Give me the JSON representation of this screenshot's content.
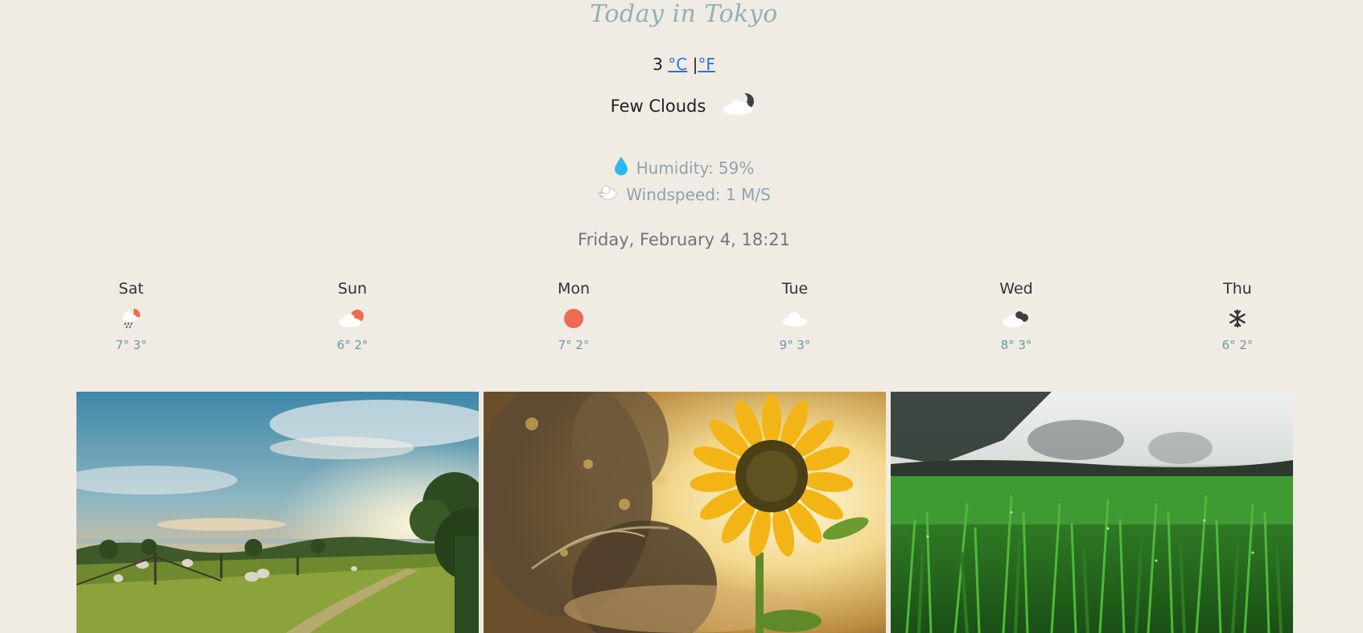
{
  "header": {
    "title": "Today in Tokyo"
  },
  "current": {
    "temp": "3",
    "unit_c": "°C",
    "separator": "|",
    "unit_f": "°F",
    "condition": "Few Clouds",
    "condition_icon": "cloud-moon-icon",
    "humidity_label": "Humidity: 59%",
    "humidity_icon": "water-drop-icon",
    "wind_label": "Windspeed: 1 M/S",
    "wind_icon": "wind-icon",
    "datetime": "Friday, February 4, 18:21"
  },
  "forecast": [
    {
      "day": "Sat",
      "temps": "7° 3°",
      "icon": "sun-cloud-rain-icon"
    },
    {
      "day": "Sun",
      "temps": "6° 2°",
      "icon": "sun-cloud-icon"
    },
    {
      "day": "Mon",
      "temps": "7° 2°",
      "icon": "sun-icon"
    },
    {
      "day": "Tue",
      "temps": "9° 3°",
      "icon": "cloud-icon"
    },
    {
      "day": "Wed",
      "temps": "8° 3°",
      "icon": "dark-clouds-icon"
    },
    {
      "day": "Thu",
      "temps": "6° 2°",
      "icon": "snowflake-icon"
    }
  ],
  "photos": [
    {
      "icon": "farm-landscape-photo"
    },
    {
      "icon": "sunflower-photo"
    },
    {
      "icon": "grass-photo"
    }
  ],
  "colors": {
    "accent": "#8fb1b8",
    "link": "#2d6fe3",
    "sun": "#ed6b4e",
    "drop": "#2bb8f0",
    "background": "#f0ebe3"
  }
}
